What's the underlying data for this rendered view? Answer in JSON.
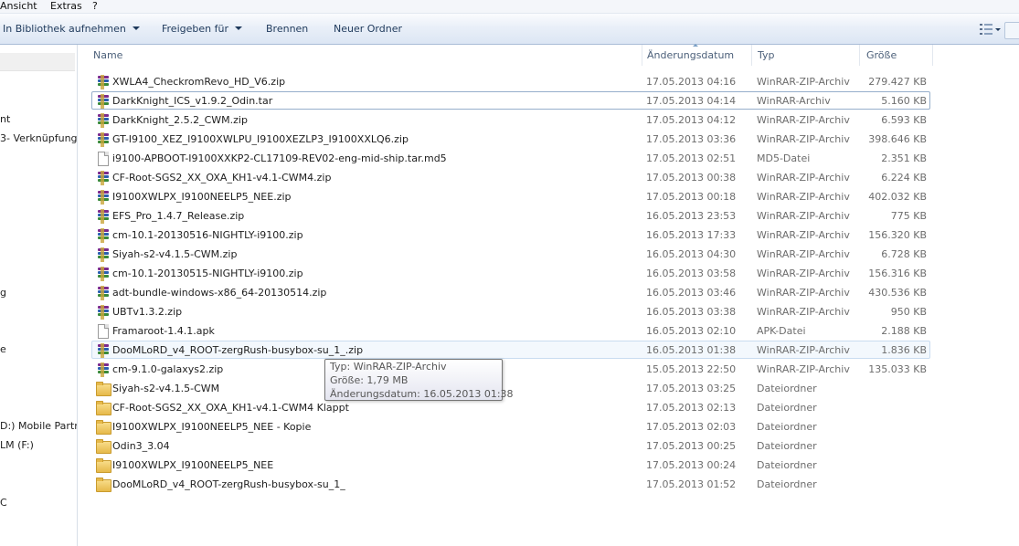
{
  "menu": {
    "items": [
      "Ansicht",
      "Extras",
      "?"
    ]
  },
  "toolbar": {
    "library": "In Bibliothek aufnehmen",
    "share": "Freigeben für",
    "burn": "Brennen",
    "new_folder": "Neuer Ordner"
  },
  "nav": {
    "items": [
      "nt",
      "3- Verknüpfung",
      "g",
      "e",
      "D:) Mobile Partn",
      "LM (F:)",
      "C"
    ]
  },
  "columns": {
    "name": "Name",
    "date": "Änderungsdatum",
    "type": "Typ",
    "size": "Größe"
  },
  "files": [
    {
      "icon": "winrar-archive-icon",
      "name": "XWLA4_CheckromRevo_HD_V6.zip",
      "date": "17.05.2013 04:16",
      "type": "WinRAR-ZIP-Archiv",
      "size": "279.427 KB"
    },
    {
      "icon": "winrar-archive-icon",
      "name": "DarkKnight_ICS_v1.9.2_Odin.tar",
      "date": "17.05.2013 04:14",
      "type": "WinRAR-Archiv",
      "size": "5.160 KB"
    },
    {
      "icon": "winrar-archive-icon",
      "name": "DarkKnight_2.5.2_CWM.zip",
      "date": "17.05.2013 04:12",
      "type": "WinRAR-ZIP-Archiv",
      "size": "6.593 KB"
    },
    {
      "icon": "winrar-archive-icon",
      "name": "GT-I9100_XEZ_I9100XWLPU_I9100XEZLP3_I9100XXLQ6.zip",
      "date": "17.05.2013 03:36",
      "type": "WinRAR-ZIP-Archiv",
      "size": "398.646 KB"
    },
    {
      "icon": "file-icon",
      "name": "i9100-APBOOT-I9100XXKP2-CL17109-REV02-eng-mid-ship.tar.md5",
      "date": "17.05.2013 02:51",
      "type": "MD5-Datei",
      "size": "2.351 KB"
    },
    {
      "icon": "winrar-archive-icon",
      "name": "CF-Root-SGS2_XX_OXA_KH1-v4.1-CWM4.zip",
      "date": "17.05.2013 00:38",
      "type": "WinRAR-ZIP-Archiv",
      "size": "6.224 KB"
    },
    {
      "icon": "winrar-archive-icon",
      "name": "I9100XWLPX_I9100NEELP5_NEE.zip",
      "date": "17.05.2013 00:18",
      "type": "WinRAR-ZIP-Archiv",
      "size": "402.032 KB"
    },
    {
      "icon": "winrar-archive-icon",
      "name": "EFS_Pro_1.4.7_Release.zip",
      "date": "16.05.2013 23:53",
      "type": "WinRAR-ZIP-Archiv",
      "size": "775 KB"
    },
    {
      "icon": "winrar-archive-icon",
      "name": "cm-10.1-20130516-NIGHTLY-i9100.zip",
      "date": "16.05.2013 17:33",
      "type": "WinRAR-ZIP-Archiv",
      "size": "156.320 KB"
    },
    {
      "icon": "winrar-archive-icon",
      "name": "Siyah-s2-v4.1.5-CWM.zip",
      "date": "16.05.2013 04:30",
      "type": "WinRAR-ZIP-Archiv",
      "size": "6.728 KB"
    },
    {
      "icon": "winrar-archive-icon",
      "name": "cm-10.1-20130515-NIGHTLY-i9100.zip",
      "date": "16.05.2013 03:58",
      "type": "WinRAR-ZIP-Archiv",
      "size": "156.316 KB"
    },
    {
      "icon": "winrar-archive-icon",
      "name": "adt-bundle-windows-x86_64-20130514.zip",
      "date": "16.05.2013 03:46",
      "type": "WinRAR-ZIP-Archiv",
      "size": "430.536 KB"
    },
    {
      "icon": "winrar-archive-icon",
      "name": "UBTv1.3.2.zip",
      "date": "16.05.2013 03:38",
      "type": "WinRAR-ZIP-Archiv",
      "size": "950 KB"
    },
    {
      "icon": "file-icon",
      "name": "Framaroot-1.4.1.apk",
      "date": "16.05.2013 02:10",
      "type": "APK-Datei",
      "size": "2.188 KB"
    },
    {
      "icon": "winrar-archive-icon",
      "name": "DooMLoRD_v4_ROOT-zergRush-busybox-su_1_.zip",
      "date": "16.05.2013 01:38",
      "type": "WinRAR-ZIP-Archiv",
      "size": "1.836 KB"
    },
    {
      "icon": "winrar-archive-icon",
      "name": "cm-9.1.0-galaxys2.zip",
      "date": "15.05.2013 22:50",
      "type": "WinRAR-ZIP-Archiv",
      "size": "135.033 KB"
    },
    {
      "icon": "folder-icon",
      "name": "Siyah-s2-v4.1.5-CWM",
      "date": "17.05.2013 03:25",
      "type": "Dateiordner",
      "size": ""
    },
    {
      "icon": "folder-icon",
      "name": "CF-Root-SGS2_XX_OXA_KH1-v4.1-CWM4 Klappt",
      "date": "17.05.2013 02:13",
      "type": "Dateiordner",
      "size": ""
    },
    {
      "icon": "folder-icon",
      "name": "I9100XWLPX_I9100NEELP5_NEE - Kopie",
      "date": "17.05.2013 02:03",
      "type": "Dateiordner",
      "size": ""
    },
    {
      "icon": "folder-icon",
      "name": "Odin3_3.04",
      "date": "17.05.2013 00:25",
      "type": "Dateiordner",
      "size": ""
    },
    {
      "icon": "folder-icon",
      "name": "I9100XWLPX_I9100NEELP5_NEE",
      "date": "17.05.2013 00:24",
      "type": "Dateiordner",
      "size": ""
    },
    {
      "icon": "folder-icon",
      "name": "DooMLoRD_v4_ROOT-zergRush-busybox-su_1_",
      "date": "17.05.2013 01:52",
      "type": "Dateiordner",
      "size": ""
    }
  ],
  "tooltip": {
    "type_line": "Typ: WinRAR-ZIP-Archiv",
    "size_line": "Größe: 1,79 MB",
    "date_line": "Änderungsdatum: 16.05.2013 01:38"
  }
}
